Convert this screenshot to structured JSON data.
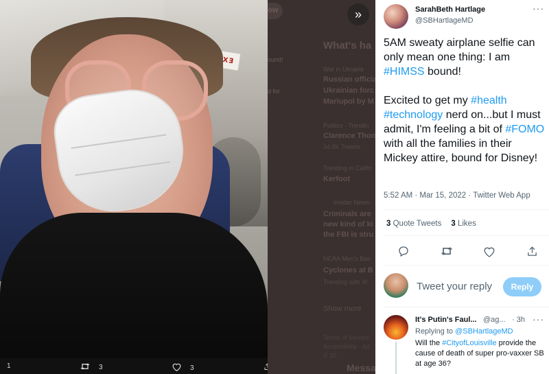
{
  "photo": {
    "exit_sign": "EXIT SALIDA"
  },
  "photo_actions": {
    "reply_count": "1",
    "retweet_count": "3",
    "like_count": "3"
  },
  "background_page": {
    "follow_label": "llow",
    "heading": "What's ha",
    "left_col": [
      "ound!",
      "d for"
    ],
    "trends": [
      {
        "category": "War in Ukraine",
        "lines": [
          "Russian officia",
          "Ukrainian forc",
          "Mariupol by M"
        ]
      },
      {
        "category": "Politics · Trendin",
        "lines": [
          "Clarence Thom"
        ],
        "sub": "34.8K Tweets"
      },
      {
        "category": "Trending in Califo",
        "lines": [
          "Kerfoot"
        ]
      },
      {
        "category": "Insider News",
        "lines": [
          "Criminals are",
          "new kind of ki",
          "the FBI is stru"
        ]
      },
      {
        "category": "NCAA Men's Bas",
        "lines": [
          "Cyclones at B"
        ],
        "sub": "Trending with W"
      }
    ],
    "show_more": "Show more",
    "footer": [
      "Terms of Service",
      "Accessibility · Ad",
      "© 20"
    ],
    "messages": "Messa"
  },
  "tweet": {
    "author_name": "SarahBeth Hartlage",
    "author_handle": "@SBHartlageMD",
    "text_parts": [
      {
        "t": "5AM sweaty airplane selfie can only mean one thing: I am ",
        "ht": false
      },
      {
        "t": "#HIMSS",
        "ht": true
      },
      {
        "t": " bound!\n\nExcited to get my ",
        "ht": false
      },
      {
        "t": "#health",
        "ht": true
      },
      {
        "t": "\n",
        "ht": false
      },
      {
        "t": "#technology",
        "ht": true
      },
      {
        "t": " nerd on...but I must admit, I'm feeling a bit of ",
        "ht": false
      },
      {
        "t": "#FOMO",
        "ht": true
      },
      {
        "t": " with all the families in their Mickey attire, bound for Disney!",
        "ht": false
      }
    ],
    "meta": "5:52 AM · Mar 15, 2022 · Twitter Web App",
    "quote_tweets_count": "3",
    "quote_tweets_label": "Quote Tweets",
    "likes_count": "3",
    "likes_label": "Likes"
  },
  "compose": {
    "placeholder": "Tweet your reply",
    "reply_button": "Reply"
  },
  "reply": {
    "name": "It's Putin's Faul...",
    "handle": "@ag...",
    "time": "· 3h",
    "replying_prefix": "Replying to ",
    "replying_to": "@SBHartlageMD",
    "text_parts": [
      {
        "t": "Will the ",
        "ht": false
      },
      {
        "t": "#CityofLouisville",
        "ht": true
      },
      {
        "t": " provide the cause of death of super pro-vaxxer SB at age 36?",
        "ht": false
      }
    ]
  },
  "icons": {
    "reply": "reply-icon",
    "retweet": "retweet-icon",
    "like": "heart-icon",
    "share": "share-icon",
    "expand": "expand-icon",
    "more": "more-icon"
  },
  "colors": {
    "accent": "#1d9bf0",
    "reply_button_disabled": "#8ecdf8",
    "secondary_text": "#536471"
  }
}
